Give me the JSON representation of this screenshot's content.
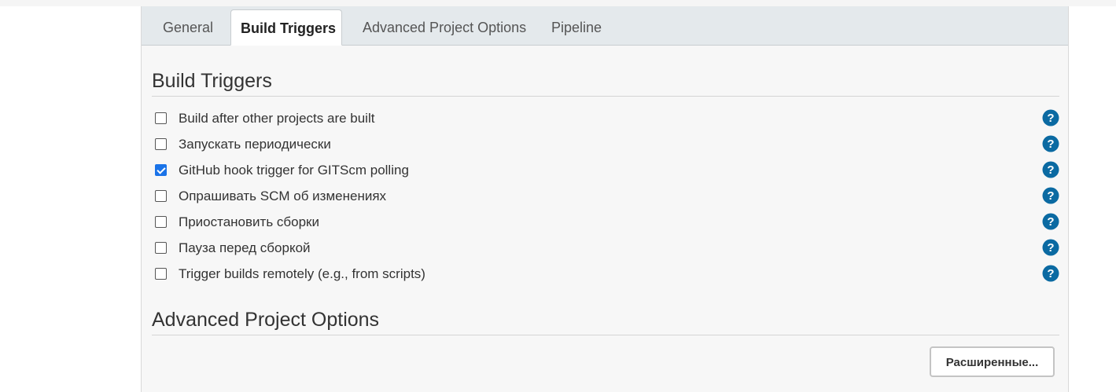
{
  "tabs": [
    {
      "label": "General",
      "active": false
    },
    {
      "label": "Build Triggers",
      "active": true
    },
    {
      "label": "Advanced Project Options",
      "active": false
    },
    {
      "label": "Pipeline",
      "active": false
    }
  ],
  "build_triggers": {
    "title": "Build Triggers",
    "items": [
      {
        "label": "Build after other projects are built",
        "checked": false,
        "help_icon": "question-circle-icon"
      },
      {
        "label": "Запускать периодически",
        "checked": false,
        "help_icon": "question-circle-icon"
      },
      {
        "label": "GitHub hook trigger for GITScm polling",
        "checked": true,
        "help_icon": "question-circle-icon"
      },
      {
        "label": "Опрашивать SCM об изменениях",
        "checked": false,
        "help_icon": "question-circle-icon"
      },
      {
        "label": "Приостановить сборки",
        "checked": false,
        "help_icon": "question-circle-icon"
      },
      {
        "label": "Пауза перед сборкой",
        "checked": false,
        "help_icon": "question-circle-icon"
      },
      {
        "label": "Trigger builds remotely (e.g., from scripts)",
        "checked": false,
        "help_icon": "question-circle-icon"
      }
    ]
  },
  "advanced_project_options": {
    "title": "Advanced Project Options",
    "advanced_button_label": "Расширенные..."
  },
  "colors": {
    "help_icon": "#0b6aa2",
    "checkbox_checked": "#1a73e8",
    "tabbar_bg": "#e4e9ec",
    "panel_bg": "#f7f7f7"
  }
}
